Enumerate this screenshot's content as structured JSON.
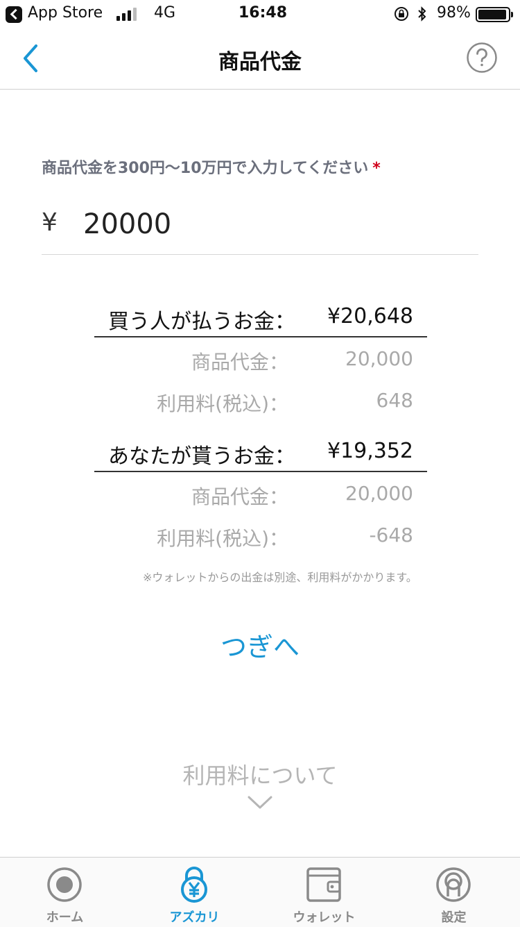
{
  "status_bar": {
    "back_app": "App Store",
    "network": "4G",
    "time": "16:48",
    "battery": "98%"
  },
  "nav": {
    "title": "商品代金"
  },
  "form": {
    "prompt": "商品代金を300円〜10万円で入力してください",
    "required_mark": "*",
    "currency_symbol": "¥",
    "amount_value": "20000"
  },
  "buyer": {
    "label": "買う人が払うお金：",
    "total": "¥20,648",
    "items": [
      {
        "label": "商品代金：",
        "value": "20,000"
      },
      {
        "label": "利用料(税込)：",
        "value": "648"
      }
    ]
  },
  "seller": {
    "label": "あなたが貰うお金：",
    "total": "¥19,352",
    "items": [
      {
        "label": "商品代金：",
        "value": "20,000"
      },
      {
        "label": "利用料(税込)：",
        "value": "-648"
      }
    ]
  },
  "note": "※ウォレットからの出金は別途、利用料がかかります。",
  "next_label": "つぎへ",
  "fee_about_label": "利用料について",
  "tabs": [
    {
      "label": "ホーム",
      "icon": "home-record-icon",
      "active": false
    },
    {
      "label": "アズカリ",
      "icon": "lock-yen-icon",
      "active": true
    },
    {
      "label": "ウォレット",
      "icon": "wallet-icon",
      "active": false
    },
    {
      "label": "設定",
      "icon": "settings-icon",
      "active": false
    }
  ],
  "colors": {
    "accent": "#1a96d4",
    "required": "#d0021b",
    "muted": "#a9a9a9"
  }
}
